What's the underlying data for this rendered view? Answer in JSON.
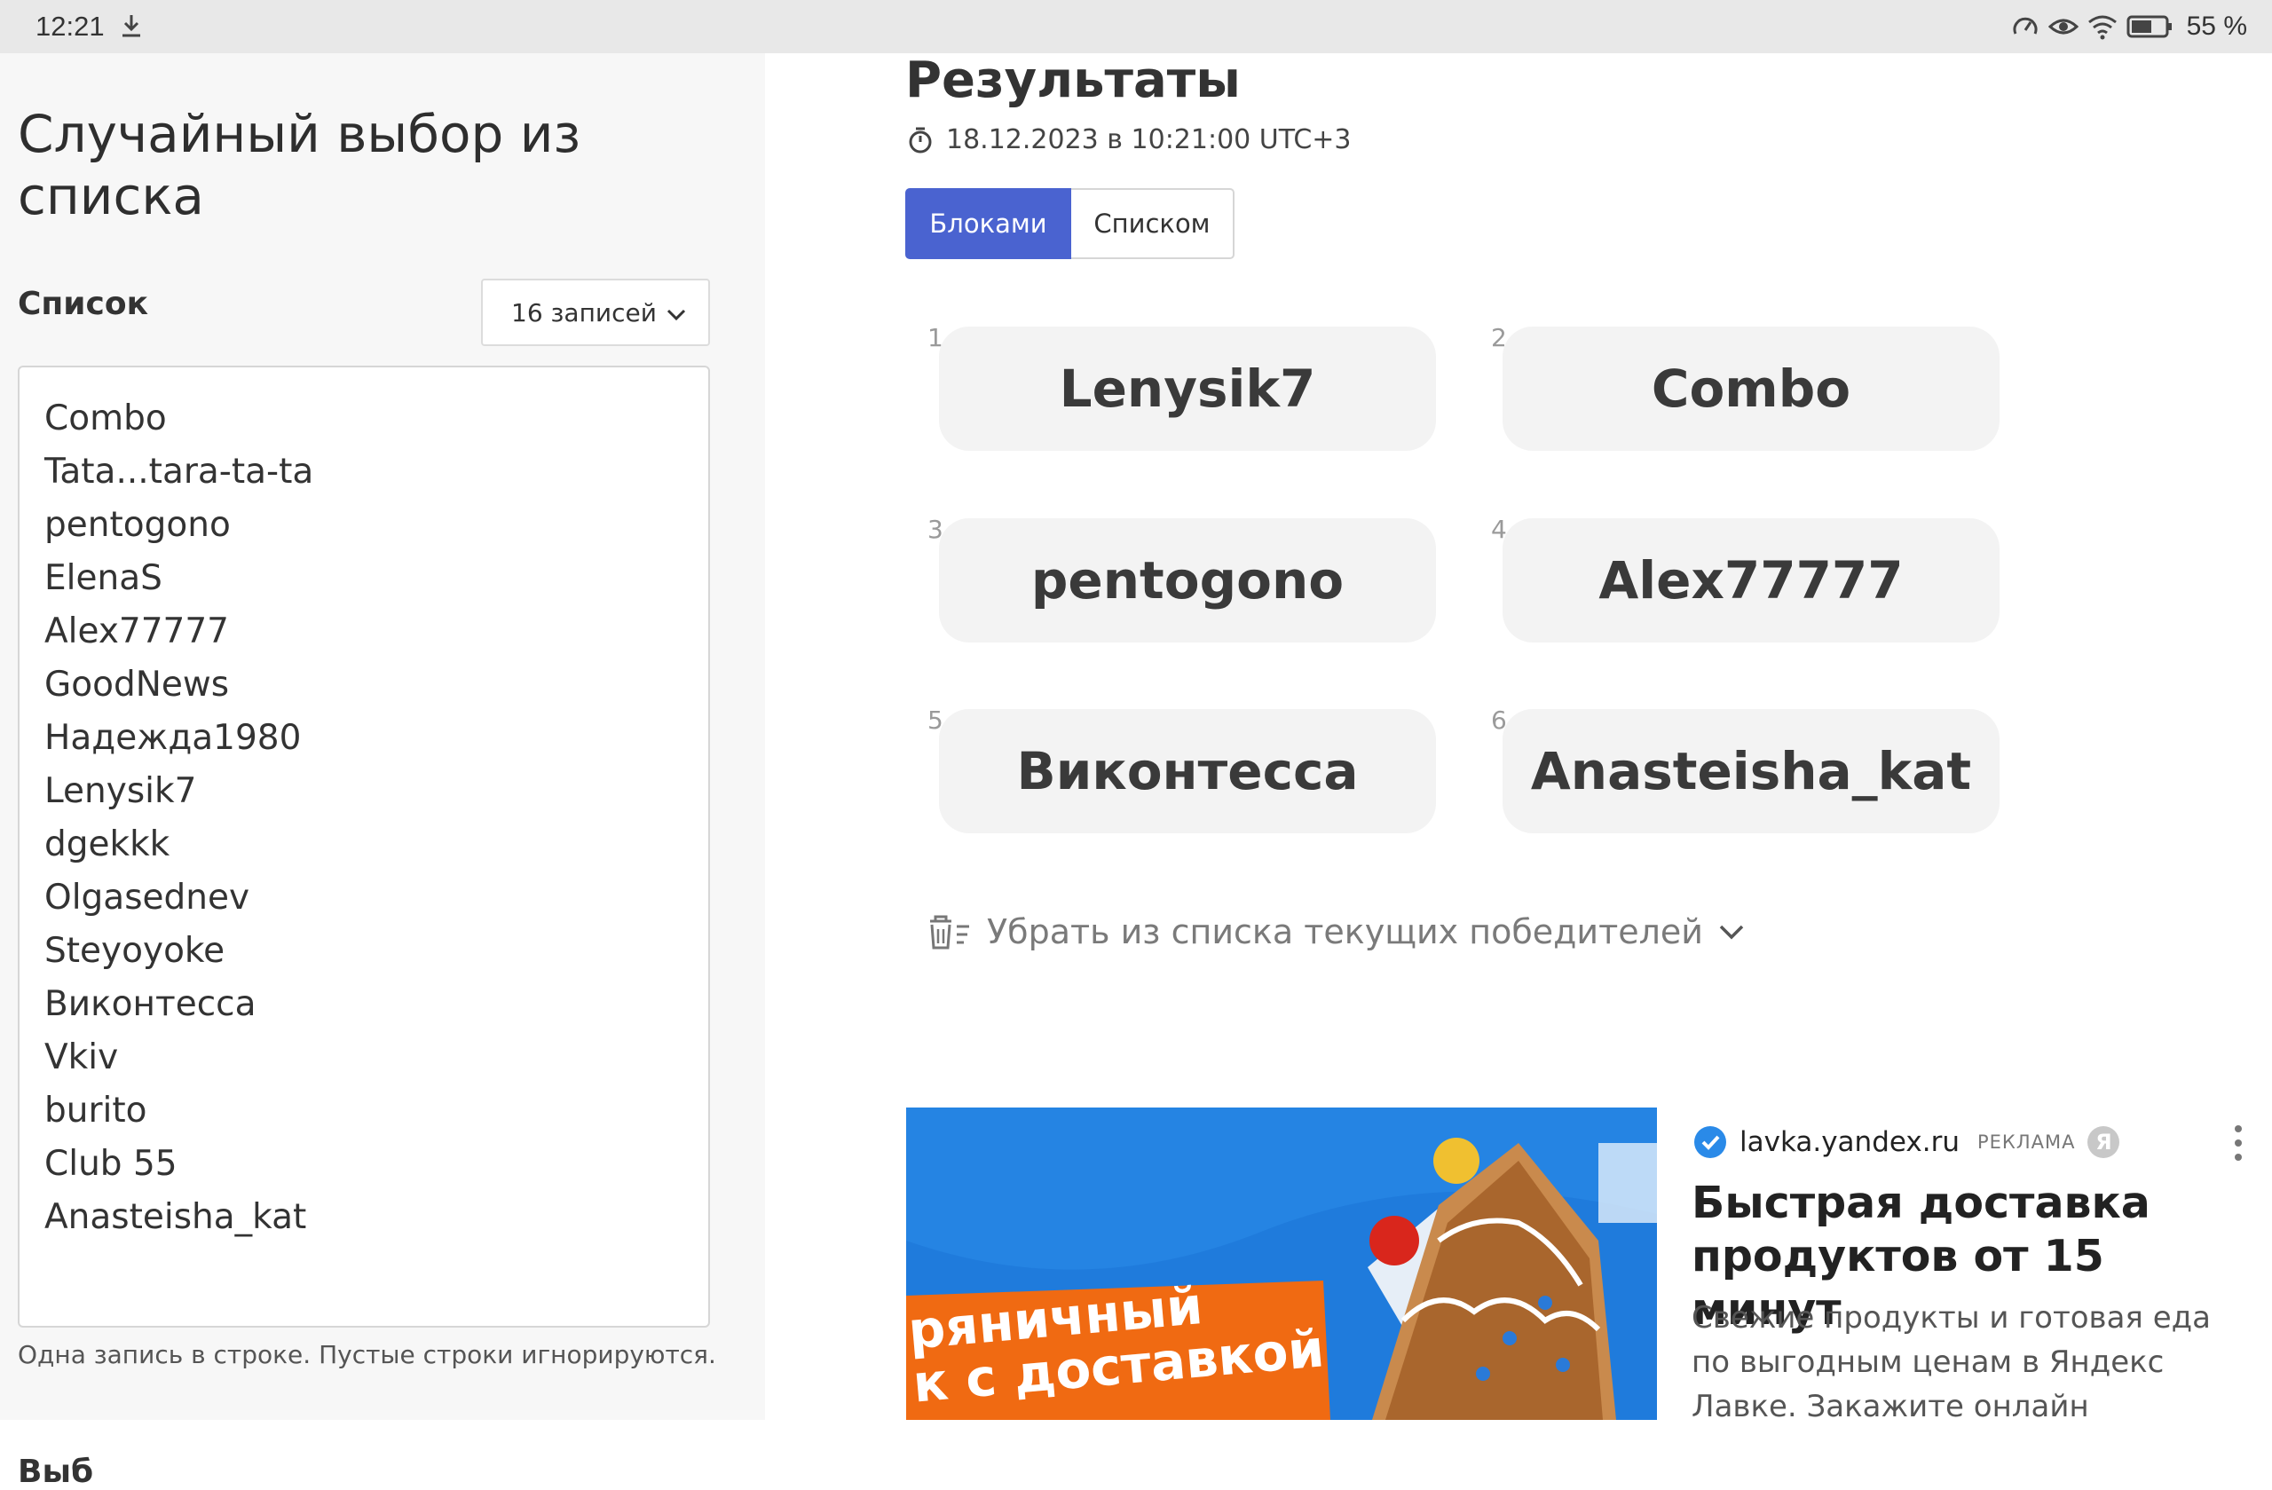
{
  "status_bar": {
    "time": "12:21",
    "battery": "55 %"
  },
  "left": {
    "title": "Случайный выбор из списка",
    "list_label": "Список",
    "count_dropdown": "16 записей",
    "entries": [
      "Combo",
      "Tata...tara-ta-ta",
      "pentogono",
      "ElenaS",
      "Alex77777",
      "GoodNews",
      "Надежда1980",
      "Lenysik7",
      "dgekkk",
      "Olgasednev",
      "Steyoyoke",
      "Виконтесса",
      "Vkiv",
      "burito",
      "Club 55",
      "Anasteisha_kat"
    ],
    "hint": "Одна запись в строке. Пустые строки игнорируются.",
    "next_label": "Выб"
  },
  "results": {
    "title": "Результаты",
    "timestamp": "18.12.2023 в 10:21:00 UTC+3",
    "view_tabs": [
      "Блоками",
      "Списком"
    ],
    "active_tab": "Блоками",
    "winners": [
      {
        "num": "1",
        "name": "Lenysik7"
      },
      {
        "num": "2",
        "name": "Combo"
      },
      {
        "num": "3",
        "name": "pentogono"
      },
      {
        "num": "4",
        "name": "Alex77777"
      },
      {
        "num": "5",
        "name": "Виконтесса"
      },
      {
        "num": "6",
        "name": "Anasteisha_kat"
      }
    ],
    "remove_winners": "Убрать из списка текущих победителей"
  },
  "ad": {
    "domain": "lavka.yandex.ru",
    "tag": "РЕКЛАМА",
    "ya_badge": "Я",
    "headline": "Быстрая доставка продуктов от 15 минут",
    "description": "Свежие продукты и готовая еда по выгодным ценам в Яндекс Лавке. Закажите онлайн",
    "banner_text_1": "ряничный",
    "banner_text_2": "к с доставкой"
  },
  "colors": {
    "accent": "#4a63d0",
    "card_bg": "#f3f3f3",
    "left_bg": "#f7f7f7",
    "ad_blue": "#1f7bdc",
    "ad_orange": "#f06a12"
  }
}
